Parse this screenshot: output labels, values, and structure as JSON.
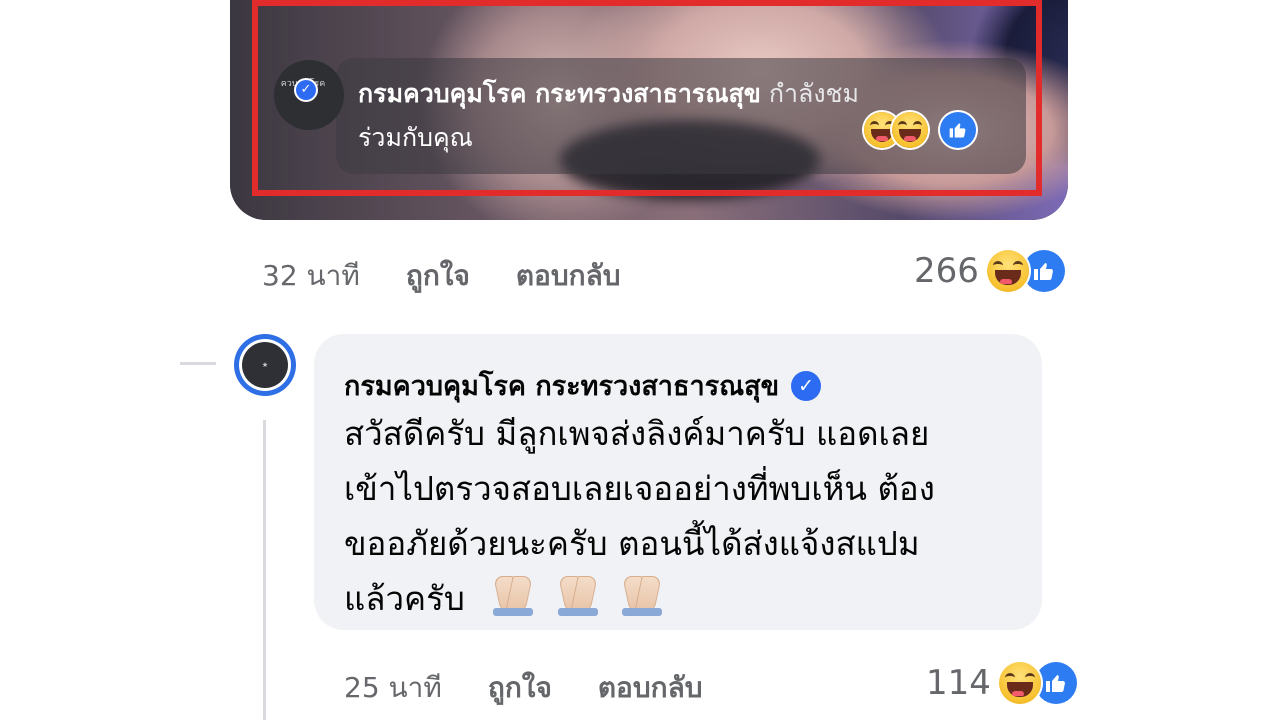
{
  "post_media": {
    "page_name": "กรมควบคุมโรค กระทรวงสาธารณสุข",
    "watching_text": "กำลังชม",
    "watching_text_2": "ร่วมกับคุณ",
    "avatar_text": "ควบคุมโรค",
    "frame_color": "#e22b2b"
  },
  "comment1": {
    "time": "32 นาที",
    "like_label": "ถูกใจ",
    "reply_label": "ตอบกลับ",
    "reaction_count": "266"
  },
  "reply": {
    "author": "กรมควบคุมโรค กระทรวงสาธารณสุข",
    "verified": true,
    "lines": [
      "สวัสดีครับ มีลูกเพจส่งลิงค์มาครับ แอดเลย",
      "เข้าไปตรวจสอบเลยเจออย่างที่พบเห็น ต้อง",
      "ขออภัยด้วยนะครับ ตอนนี้ได้ส่งแจ้งสแปม",
      "แล้วครับ"
    ],
    "emojis": [
      "pray-icon",
      "pray-icon",
      "pray-icon"
    ],
    "time": "25 นาที",
    "like_label": "ถูกใจ",
    "reply_label": "ตอบกลับ",
    "reaction_count": "114"
  },
  "colors": {
    "accent": "#2d6bf2",
    "bubble_bg": "#f0f2f5",
    "meta_text": "#65676b"
  }
}
